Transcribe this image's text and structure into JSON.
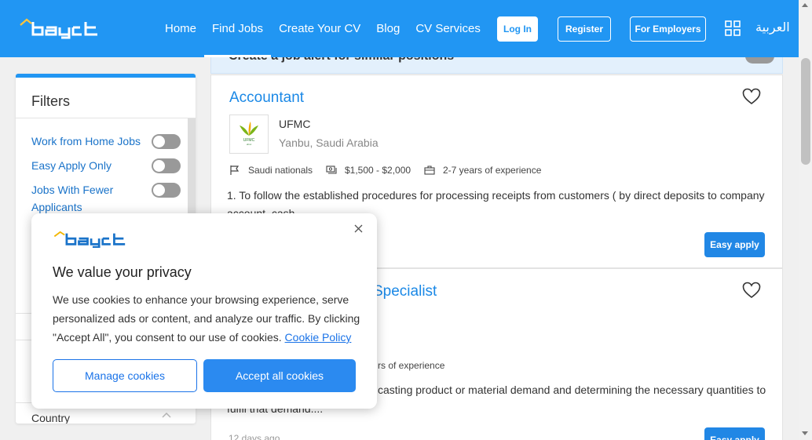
{
  "brand": {
    "accent": "#2196f3",
    "link": "#1a88e6"
  },
  "header": {
    "nav": [
      "Home",
      "Find Jobs",
      "Create Your CV",
      "Blog",
      "CV Services"
    ],
    "login": "Log In",
    "register": "Register",
    "employers": "For Employers",
    "language": "العربية"
  },
  "alert": {
    "text": "Create a job alert for similar positions"
  },
  "filters": {
    "title": "Filters",
    "items": [
      {
        "label": "Work from Home Jobs",
        "on": false
      },
      {
        "label": "Easy Apply Only",
        "on": false
      },
      {
        "label": "Jobs With Fewer Applicants",
        "on": false
      }
    ],
    "country_label": "Country"
  },
  "jobs": [
    {
      "title": "Accountant",
      "company": "UFMC",
      "location": "Yanbu, Saudi Arabia",
      "nationality": "Saudi nationals",
      "salary": "$1,500 - $2,000",
      "experience": "2-7 years of experience",
      "description": "1. To follow the established procedures for processing receipts from customers ( by direct deposits to company account, cash",
      "apply": "Easy apply"
    },
    {
      "title": "Specialist",
      "experience": "rs of experience",
      "description": "casting product or material demand and determining the necessary quantities to",
      "description_line2": "fulfil that demand....",
      "days_ago": "12 days ago",
      "apply": "Easy apply"
    }
  ],
  "cookie": {
    "title": "We value your privacy",
    "text": "We use cookies to enhance your browsing experience, serve personalized ads or content, and analyze our traffic. By clicking \"Accept All\", you consent to our use of cookies.",
    "policy_link": "Cookie Policy",
    "manage": "Manage cookies",
    "accept": "Accept all cookies"
  }
}
